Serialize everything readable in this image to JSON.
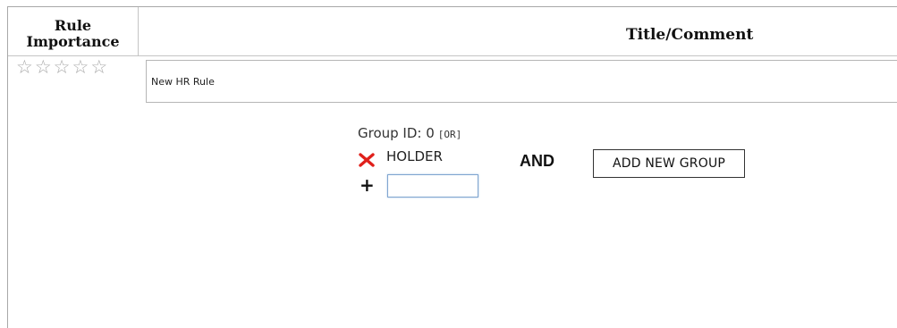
{
  "header": {
    "importance_label": "Rule\nImportance",
    "title_label": "Title/Comment"
  },
  "rule": {
    "importance_rating": 0,
    "importance_max": 5,
    "star_glyph": "☆",
    "title_value": "New HR Rule"
  },
  "group": {
    "id_label": "Group ID: 0",
    "operator_tag": "[OR]",
    "items": [
      "HOLDER"
    ],
    "new_item_value": ""
  },
  "joiner_label": "AND",
  "add_group_label": "ADD NEW GROUP",
  "icons": {
    "remove": "close-icon",
    "add": "plus-icon",
    "remove_color": "#e0201b"
  }
}
